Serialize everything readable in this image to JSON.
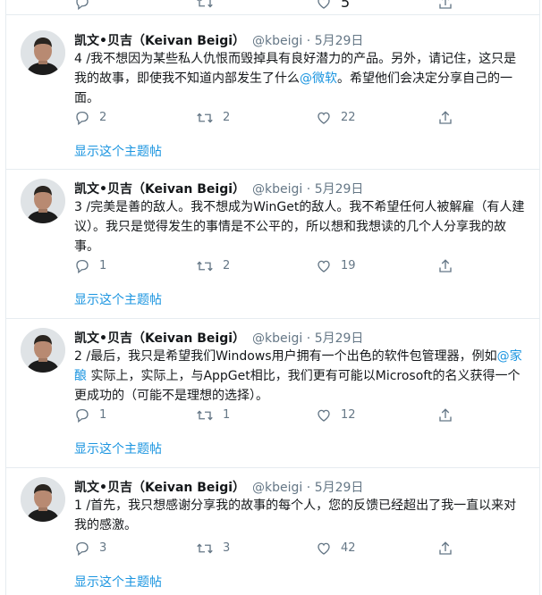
{
  "top_counts": {
    "likes": "5"
  },
  "author": {
    "name": "凯文•贝吉（Keivan Beigi）",
    "handle": "@kbeigi",
    "dot": "·",
    "date": "5月29日"
  },
  "show_thread_label": "显示这个主题帖",
  "tweets": [
    {
      "text_before": "4 /我不想因为某些私人仇恨而毁掉具有良好潜力的产品。另外，请记住，这只是我的故事，即使我不知道内部发生了什么",
      "mention": "@微软",
      "text_after": "。希望他们会决定分享自己的一面。",
      "replies": "2",
      "retweets": "2",
      "likes": "22"
    },
    {
      "text_before": "3 /完美是善的敌人。我不想成为WinGet的敌人。我不希望任何人被解雇（有人建议）。我只是觉得发生的事情是不公平的，所以想和我想读的几个人分享我的故事。",
      "mention": "",
      "text_after": "",
      "replies": "1",
      "retweets": "2",
      "likes": "19"
    },
    {
      "text_before": "2 /最后，我只是希望我们Windows用户拥有一个出色的软件包管理器，例如",
      "mention": "@家酿",
      "text_after": " 实际上，实际上，与AppGet相比，我们更有可能以Microsoft的名义获得一个更成功的（可能不是理想的选择）。",
      "replies": "1",
      "retweets": "1",
      "likes": "12"
    },
    {
      "text_before": "1 /首先，我只想感谢分享我的故事的每个人，您的反馈已经超出了我一直以来对我的感激。",
      "mention": "",
      "text_after": "",
      "replies": "3",
      "retweets": "3",
      "likes": "42"
    }
  ],
  "icons": {
    "reply": "reply-icon",
    "retweet": "retweet-icon",
    "like": "heart-icon",
    "share": "share-icon"
  },
  "colors": {
    "link": "#1b95e0",
    "muted": "#657786",
    "text": "#14171a",
    "border": "#e6ecf0"
  }
}
